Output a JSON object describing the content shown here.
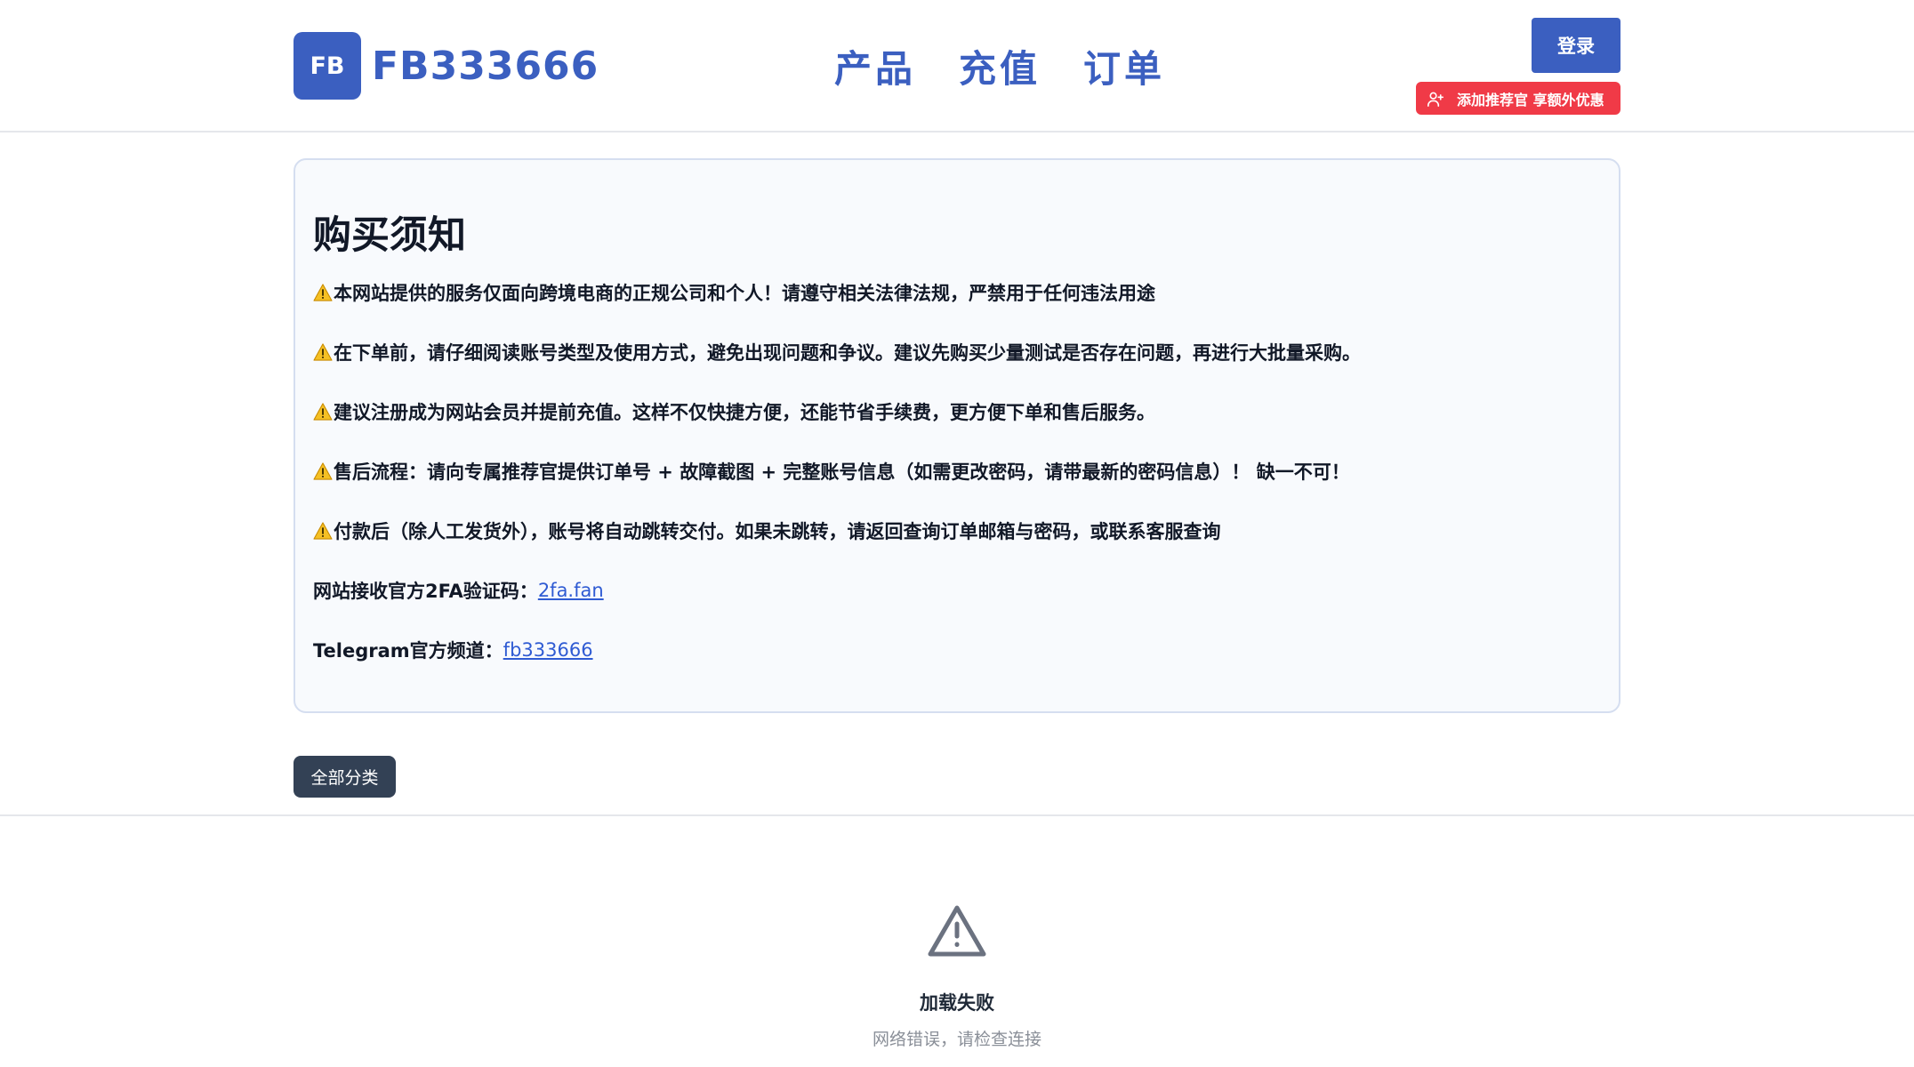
{
  "header": {
    "logo_text": "FB",
    "brand_name": "FB333666",
    "nav": [
      "产品",
      "充值",
      "订单"
    ],
    "login_label": "登录",
    "referral_label": "添加推荐官 享额外优惠"
  },
  "notice": {
    "title": "购买须知",
    "warnings": [
      "本网站提供的服务仅面向跨境电商的正规公司和个人！请遵守相关法律法规，严禁用于任何违法用途",
      "在下单前，请仔细阅读账号类型及使用方式，避免出现问题和争议。建议先购买少量测试是否存在问题，再进行大批量采购。",
      "建议注册成为网站会员并提前充值。这样不仅快捷方便，还能节省手续费，更方便下单和售后服务。",
      "售后流程：请向专属推荐官提供订单号 + 故障截图 + 完整账号信息（如需更改密码，请带最新的密码信息）！ 缺一不可！",
      "付款后（除人工发货外），账号将自动跳转交付。如果未跳转，请返回查询订单邮箱与密码，或联系客服查询"
    ],
    "twofa_label": "网站接收官方2FA验证码：",
    "twofa_link": "2fa.fan",
    "telegram_label": "Telegram官方频道：",
    "telegram_link": "fb333666"
  },
  "category": {
    "label": "全部分类"
  },
  "error": {
    "icon": "warning-triangle-icon",
    "title": "加载失败",
    "subtitle": "网络错误，请检查连接"
  },
  "colors": {
    "brand": "#3b5fc0",
    "referral": "#f03a47",
    "category": "#334155",
    "link": "#2f5bd3"
  }
}
